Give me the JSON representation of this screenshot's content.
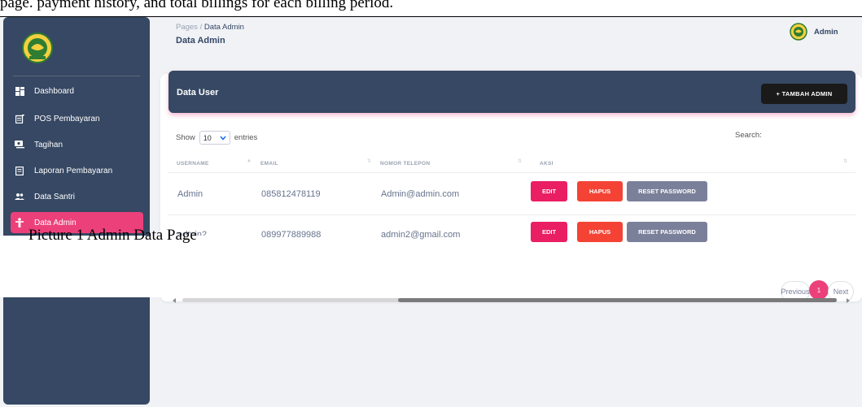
{
  "top_text": "page. payment history, and total billings for each billing period.",
  "caption": "Picture  1 Admin Data Page",
  "sidebar": {
    "items": [
      {
        "label": "Dashboard",
        "icon": "dashboard-icon"
      },
      {
        "label": "POS Pembayaran",
        "icon": "post-add-icon"
      },
      {
        "label": "Tagihan",
        "icon": "payments-icon"
      },
      {
        "label": "Laporan Pembayaran",
        "icon": "receipt-icon"
      },
      {
        "label": "Data Santri",
        "icon": "group-icon"
      },
      {
        "label": "Data Admin",
        "icon": "person-icon",
        "active": true
      }
    ]
  },
  "header": {
    "breadcrumb_root": "Pages",
    "breadcrumb_sep": "/",
    "breadcrumb_current": "Data Admin",
    "title": "Data Admin",
    "user": "Admin"
  },
  "card": {
    "title": "Data User",
    "add_button": "+ TAMBAH ADMIN",
    "show_label": "Show",
    "entries_value": "10",
    "entries_label": "entries",
    "search_label": "Search:"
  },
  "table": {
    "columns": [
      "USERNAME",
      "EMAIL",
      "NOMOR TELEPON",
      "AKSI"
    ],
    "rows": [
      {
        "username": "Admin",
        "col2": "085812478119",
        "col3": "Admin@admin.com"
      },
      {
        "username": "admin2",
        "col2": "089977889988",
        "col3": "admin2@gmail.com"
      }
    ],
    "actions": {
      "edit": "EDIT",
      "delete": "HAPUS",
      "reset": "RESET PASSWORD"
    }
  },
  "pagination": {
    "previous": "Previous",
    "current": "1",
    "next": "Next"
  },
  "scroll_position": 0.33,
  "colors": {
    "sidebar": "#364863",
    "accent": "#ec407a",
    "danger": "#f44335",
    "secondary": "#7b809a",
    "dark": "#1a1a1a"
  }
}
